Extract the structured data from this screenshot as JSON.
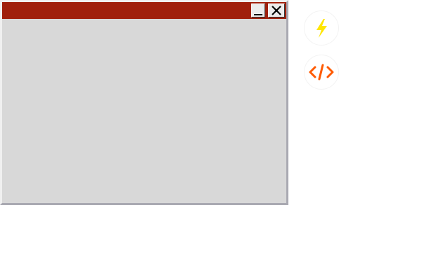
{
  "window": {
    "title": "",
    "titlebar_color": "#a0200c",
    "body_color": "#d8d8d8",
    "controls": {
      "minimize_icon": "minimize-icon",
      "close_icon": "close-icon"
    }
  },
  "desktop_icons": [
    {
      "icon": "lightning-bolt-icon",
      "color": "#ffe600"
    },
    {
      "icon": "code-brackets-icon",
      "color": "#ff5a00"
    }
  ]
}
